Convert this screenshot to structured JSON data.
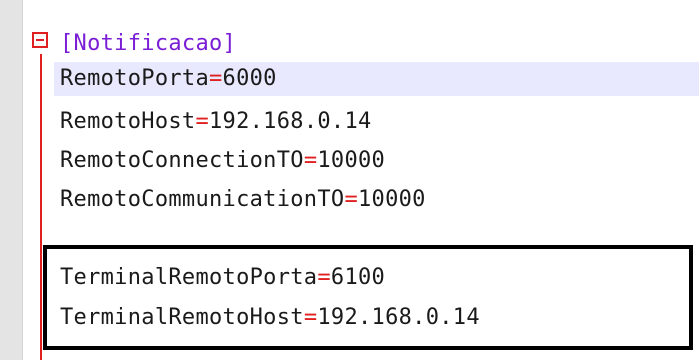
{
  "editor": {
    "section_header": "[Notificacao]",
    "lines": [
      {
        "key": "RemotoPorta",
        "eq": "=",
        "value": "6000"
      },
      {
        "key": "RemotoHost",
        "eq": "=",
        "value": "192.168.0.14"
      },
      {
        "key": "RemotoConnectionTO",
        "eq": "=",
        "value": "10000"
      },
      {
        "key": "RemotoCommunicationTO",
        "eq": "=",
        "value": "10000"
      },
      {
        "key": "TerminalRemotoPorta",
        "eq": "=",
        "value": "6100"
      },
      {
        "key": "TerminalRemotoHost",
        "eq": "=",
        "value": "192.168.0.14"
      }
    ],
    "colors": {
      "section": "#7a1fd6",
      "equals": "#e02020",
      "fold_marker": "#e02020",
      "current_line": "#e8e8ff"
    }
  }
}
